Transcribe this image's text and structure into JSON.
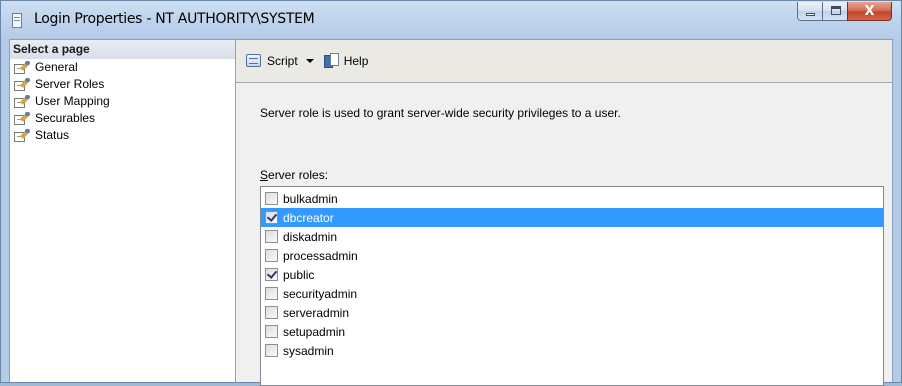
{
  "window": {
    "title": "Login Properties - NT AUTHORITY\\SYSTEM",
    "close_glyph": "X"
  },
  "sidebar": {
    "header": "Select a page",
    "items": [
      {
        "label": "General",
        "icon": "page-settings-icon"
      },
      {
        "label": "Server Roles",
        "icon": "page-settings-icon"
      },
      {
        "label": "User Mapping",
        "icon": "page-settings-icon"
      },
      {
        "label": "Securables",
        "icon": "page-settings-icon"
      },
      {
        "label": "Status",
        "icon": "page-settings-icon"
      }
    ]
  },
  "toolbar": {
    "script_label": "Script",
    "help_label": "Help"
  },
  "content": {
    "description": "Server role is used to grant server-wide security privileges to a user.",
    "roles_label_accel": "S",
    "roles_label_rest": "erver roles:",
    "roles": [
      {
        "label": "bulkadmin",
        "checked": false,
        "selected": false
      },
      {
        "label": "dbcreator",
        "checked": true,
        "selected": true
      },
      {
        "label": "diskadmin",
        "checked": false,
        "selected": false
      },
      {
        "label": "processadmin",
        "checked": false,
        "selected": false
      },
      {
        "label": "public",
        "checked": true,
        "selected": false
      },
      {
        "label": "securityadmin",
        "checked": false,
        "selected": false
      },
      {
        "label": "serveradmin",
        "checked": false,
        "selected": false
      },
      {
        "label": "setupadmin",
        "checked": false,
        "selected": false
      },
      {
        "label": "sysadmin",
        "checked": false,
        "selected": false
      }
    ]
  },
  "colors": {
    "selection": "#3399ff",
    "window_frame": "#b9cfea",
    "close_button": "#c2452a"
  }
}
